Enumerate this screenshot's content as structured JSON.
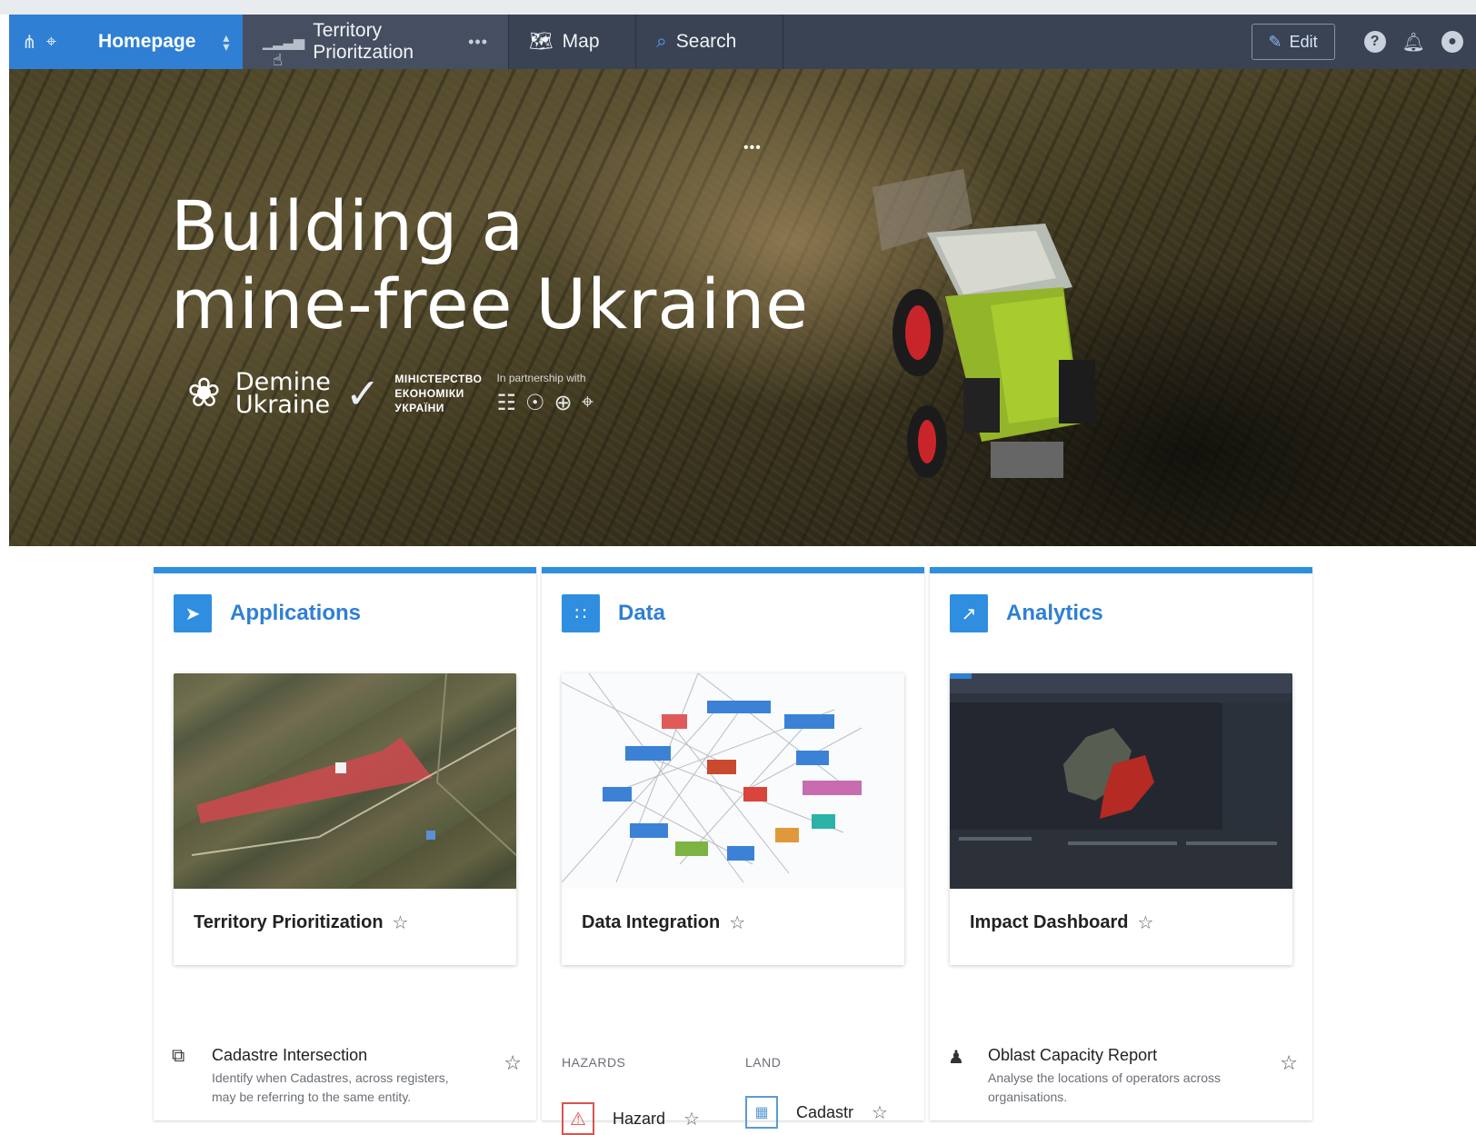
{
  "nav": {
    "home_label": "Homepage",
    "tabs": [
      {
        "label": "Territory Prioritzation",
        "icon": "bar-chart-icon",
        "more": "•••"
      },
      {
        "label": "Map",
        "icon": "map-icon"
      },
      {
        "label": "Search",
        "icon": "search-icon"
      }
    ],
    "edit_label": "Edit",
    "help_glyph": "?",
    "colors": {
      "nav_bg": "#394354",
      "home_bg": "#2f7fd4"
    }
  },
  "hero": {
    "title_line1": "Building a",
    "title_line2": "mine-free Ukraine",
    "dots": "•••",
    "demine_line1": "Demine",
    "demine_line2": "Ukraine",
    "ministry_line1": "МІНІСТЕРСТВО",
    "ministry_line2": "ЕКОНОМІКИ",
    "ministry_line3": "УКРАЇНИ",
    "partner_label": "In partnership with"
  },
  "cards": [
    {
      "title": "Applications",
      "icon": "rocket-icon",
      "feature_label": "Territory Prioritization",
      "item": {
        "title": "Cadastre Intersection",
        "desc": "Identify when Cadastres, across registers, may be referring to the same entity.",
        "icon": "intersection-icon"
      }
    },
    {
      "title": "Data",
      "icon": "dots-grid-icon",
      "feature_label": "Data Integration",
      "sections": [
        "HAZARDS",
        "LAND"
      ],
      "items": [
        {
          "label": "Hazard",
          "icon": "warning-icon"
        },
        {
          "label": "Cadastr",
          "icon": "cadastre-icon"
        }
      ]
    },
    {
      "title": "Analytics",
      "icon": "chart-icon",
      "feature_label": "Impact Dashboard",
      "item": {
        "title": "Oblast Capacity Report",
        "desc": "Analyse the locations of operators across organisations.",
        "icon": "people-icon"
      }
    }
  ],
  "accent": "#2f8ee0"
}
